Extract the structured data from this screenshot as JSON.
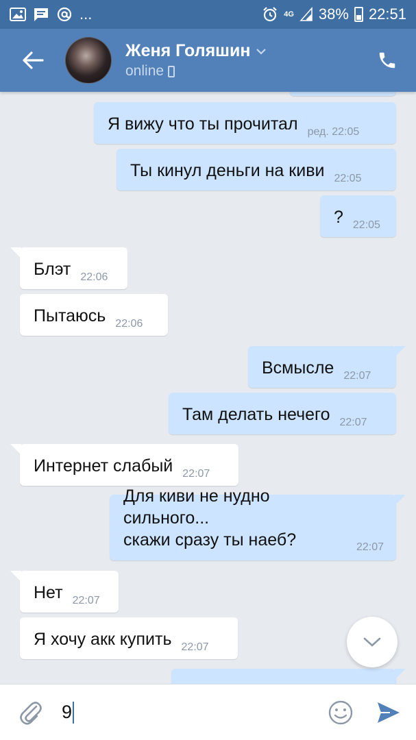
{
  "status_bar": {
    "battery": "38%",
    "time": "22:51",
    "network": "4G",
    "icons": [
      "image-icon",
      "message-icon",
      "at-icon",
      "more-dots",
      "alarm-icon",
      "signal-icon",
      "battery-icon"
    ],
    "more": "..."
  },
  "header": {
    "contact_name": "Женя Голяшин",
    "status": "online",
    "colors": {
      "bar": "#5181b8",
      "status_bar": "#3f6ea3"
    }
  },
  "messages": [
    {
      "dir": "out",
      "text": "Я вижу что ты прочитал",
      "meta": "ред. 22:05"
    },
    {
      "dir": "out",
      "text": "Ты кинул деньги на киви",
      "meta": "22:05"
    },
    {
      "dir": "out",
      "text": "?",
      "meta": "22:05"
    },
    {
      "dir": "in",
      "text": "Блэт",
      "meta": "22:06"
    },
    {
      "dir": "in",
      "text": "Пытаюсь",
      "meta": "22:06"
    },
    {
      "dir": "out",
      "text": "Всмысле",
      "meta": "22:07"
    },
    {
      "dir": "out",
      "text": "Там делать нечего",
      "meta": "22:07"
    },
    {
      "dir": "in",
      "text": "Интернет слабый",
      "meta": "22:07"
    },
    {
      "dir": "out",
      "text": "Для киви не нудно сильного...\nскажи сразу ты наеб?",
      "meta": "22:07"
    },
    {
      "dir": "in",
      "text": "Нет",
      "meta": "22:07"
    },
    {
      "dir": "in",
      "text": "Я хочу акк купить",
      "meta": "22:07"
    }
  ],
  "composer": {
    "value": "9"
  },
  "colors": {
    "outgoing_bubble": "#cce4ff",
    "incoming_bubble": "#ffffff",
    "chat_background": "#e7ebf0",
    "accent": "#5181b8"
  }
}
